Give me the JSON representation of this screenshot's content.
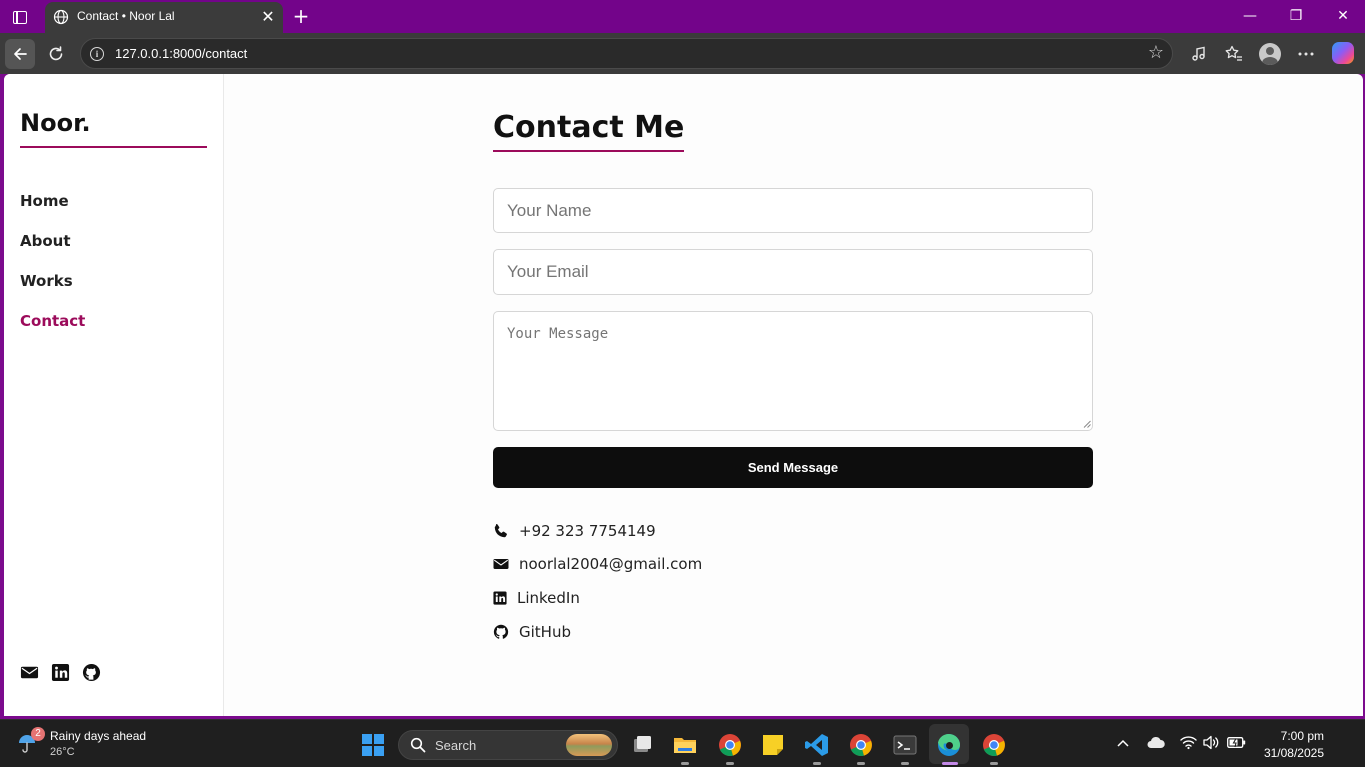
{
  "browser": {
    "tab_title": "Contact • Noor Lal",
    "tab_close": "✕",
    "new_tab": "+",
    "url": "127.0.0.1:8000/contact",
    "window_controls": {
      "minimize": "—",
      "restore": "❐",
      "close": "✕"
    }
  },
  "sidebar": {
    "logo": "Noor.",
    "nav": [
      {
        "label": "Home",
        "active": false
      },
      {
        "label": "About",
        "active": false
      },
      {
        "label": "Works",
        "active": false
      },
      {
        "label": "Contact",
        "active": true
      }
    ],
    "social_icons": [
      "envelope-icon",
      "linkedin-icon",
      "github-icon"
    ]
  },
  "contact": {
    "title": "Contact Me",
    "name_placeholder": "Your Name",
    "email_placeholder": "Your Email",
    "message_placeholder": "Your Message",
    "submit_label": "Send Message",
    "details": [
      {
        "icon": "phone-icon",
        "text": "+92 323 7754149"
      },
      {
        "icon": "envelope-icon",
        "text": "noorlal2004@gmail.com"
      },
      {
        "icon": "linkedin-icon",
        "text": "LinkedIn"
      },
      {
        "icon": "github-icon",
        "text": "GitHub"
      }
    ]
  },
  "taskbar": {
    "weather_badge": "2",
    "weather_title": "Rainy days ahead",
    "weather_temp": "26°C",
    "search_label": "Search",
    "time": "7:00 pm",
    "date": "31/08/2025"
  },
  "colors": {
    "accent": "#9c0b5b",
    "titlebar": "#73048a",
    "button": "#0d0d0d",
    "taskbar": "#1f1f1f"
  }
}
